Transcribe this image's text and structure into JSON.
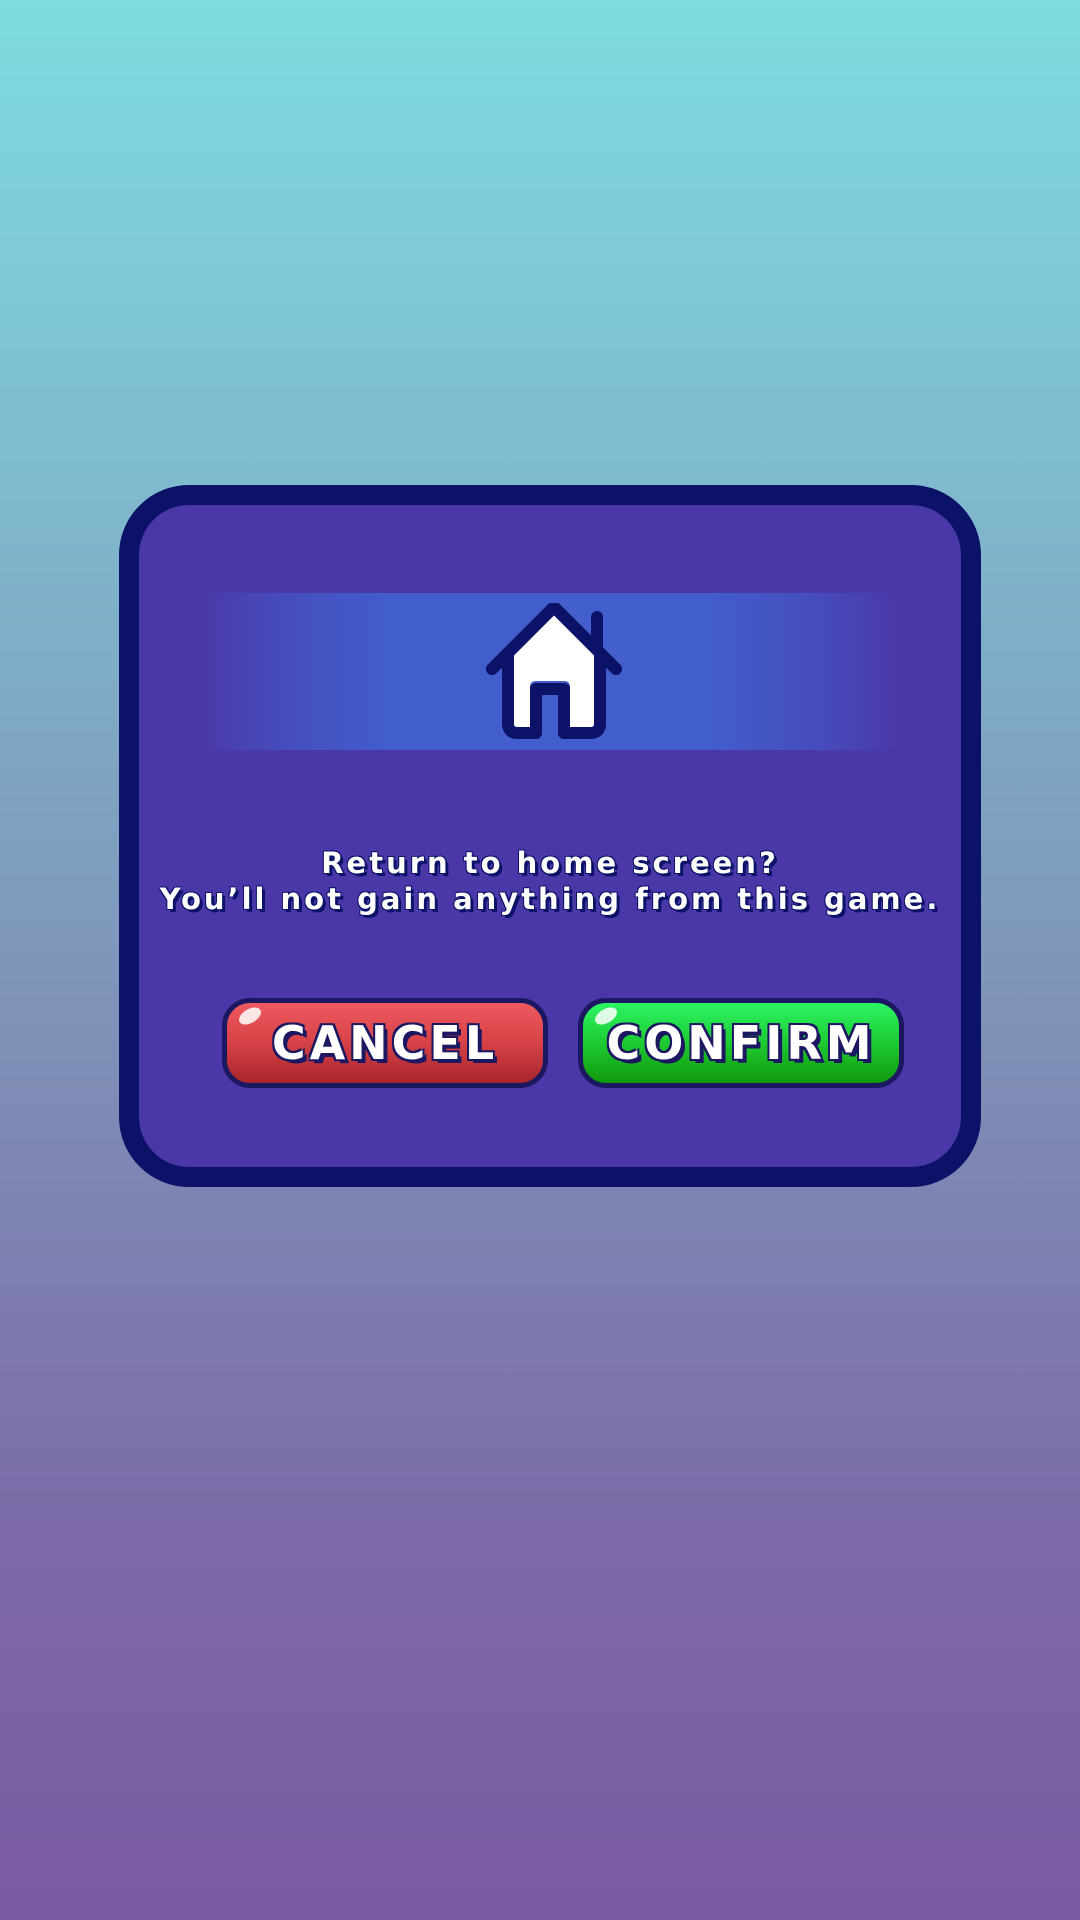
{
  "dialog": {
    "icon": "home-icon",
    "message_line1": "Return to home screen?",
    "message_line2": "You’ll not gain anything from this game.",
    "cancel_label": "CANCEL",
    "confirm_label": "CONFIRM"
  },
  "colors": {
    "panel": "#4b38a8",
    "panel_border": "#0b1268",
    "banner": "#425ecd",
    "cancel_button": "#d94449",
    "confirm_button": "#1fcf37",
    "text": "#ffffff"
  }
}
